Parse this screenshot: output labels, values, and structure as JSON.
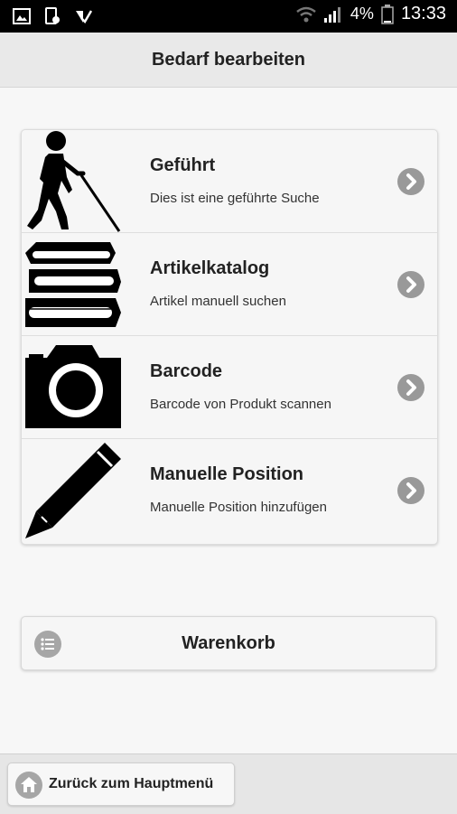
{
  "status_bar": {
    "battery_percent": "4%",
    "time": "13:33"
  },
  "header": {
    "title": "Bedarf bearbeiten"
  },
  "menu": {
    "items": [
      {
        "title": "Geführt",
        "subtitle": "Dies ist eine geführte Suche",
        "icon": "blind-person-cane-icon"
      },
      {
        "title": "Artikelkatalog",
        "subtitle": "Artikel manuell suchen",
        "icon": "book-stack-icon"
      },
      {
        "title": "Barcode",
        "subtitle": "Barcode von Produkt scannen",
        "icon": "camera-icon"
      },
      {
        "title": "Manuelle Position",
        "subtitle": "Manuelle Position hinzufügen",
        "icon": "pencil-icon"
      }
    ]
  },
  "cart": {
    "label": "Warenkorb",
    "icon": "list-icon"
  },
  "footer": {
    "back_label": "Zurück zum Hauptmenü",
    "icon": "home-icon"
  }
}
